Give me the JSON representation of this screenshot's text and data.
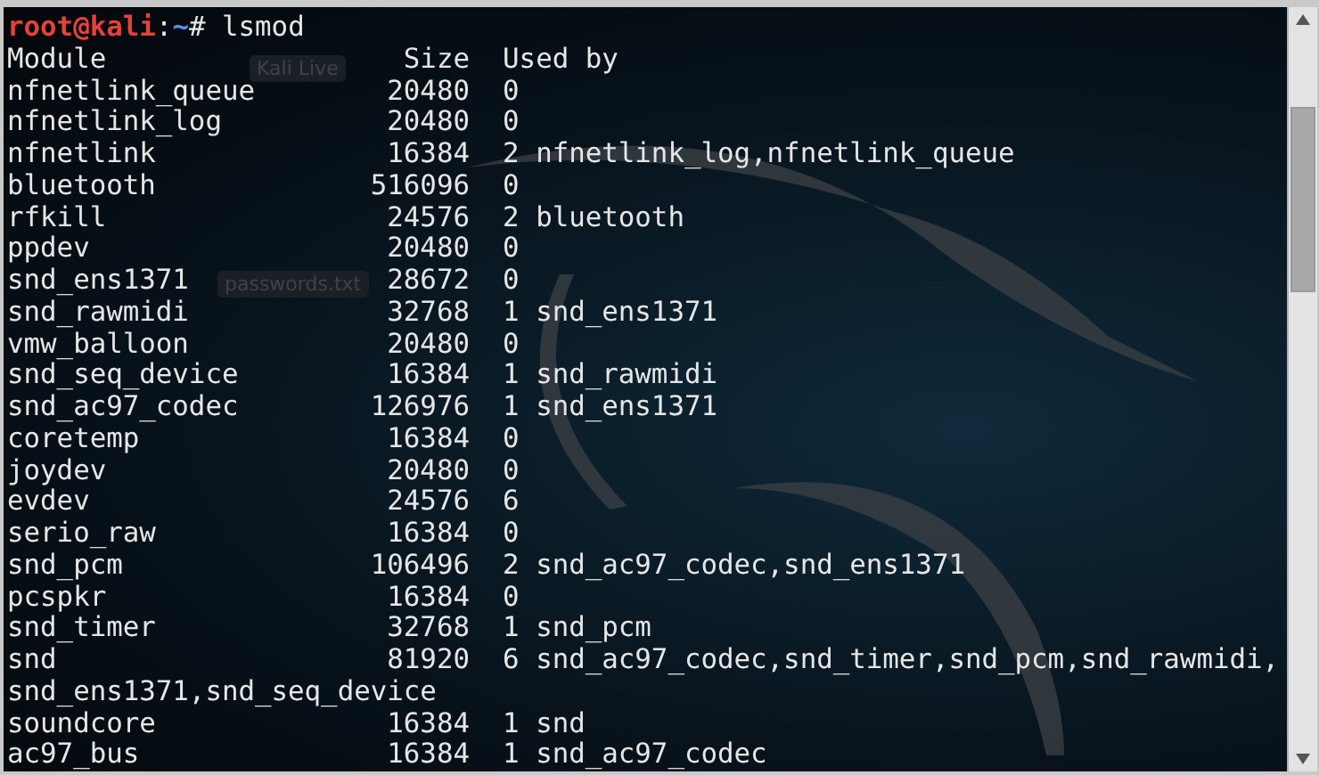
{
  "desktop_icons": [
    {
      "label": "Kali Live"
    },
    {
      "label": "passwords.txt"
    }
  ],
  "terminal": {
    "prompt": {
      "user_host": "root@kali",
      "separator": ":",
      "path": "~",
      "symbol": "#",
      "command": "lsmod"
    },
    "header": {
      "module": "Module",
      "size": "Size",
      "used_by": "Used by"
    },
    "rows": [
      {
        "module": "nfnetlink_queue",
        "size": "20480",
        "count": "0",
        "used_by": ""
      },
      {
        "module": "nfnetlink_log",
        "size": "20480",
        "count": "0",
        "used_by": ""
      },
      {
        "module": "nfnetlink",
        "size": "16384",
        "count": "2",
        "used_by": "nfnetlink_log,nfnetlink_queue"
      },
      {
        "module": "bluetooth",
        "size": "516096",
        "count": "0",
        "used_by": ""
      },
      {
        "module": "rfkill",
        "size": "24576",
        "count": "2",
        "used_by": "bluetooth"
      },
      {
        "module": "ppdev",
        "size": "20480",
        "count": "0",
        "used_by": ""
      },
      {
        "module": "snd_ens1371",
        "size": "28672",
        "count": "0",
        "used_by": ""
      },
      {
        "module": "snd_rawmidi",
        "size": "32768",
        "count": "1",
        "used_by": "snd_ens1371"
      },
      {
        "module": "vmw_balloon",
        "size": "20480",
        "count": "0",
        "used_by": ""
      },
      {
        "module": "snd_seq_device",
        "size": "16384",
        "count": "1",
        "used_by": "snd_rawmidi"
      },
      {
        "module": "snd_ac97_codec",
        "size": "126976",
        "count": "1",
        "used_by": "snd_ens1371"
      },
      {
        "module": "coretemp",
        "size": "16384",
        "count": "0",
        "used_by": ""
      },
      {
        "module": "joydev",
        "size": "20480",
        "count": "0",
        "used_by": ""
      },
      {
        "module": "evdev",
        "size": "24576",
        "count": "6",
        "used_by": ""
      },
      {
        "module": "serio_raw",
        "size": "16384",
        "count": "0",
        "used_by": ""
      },
      {
        "module": "snd_pcm",
        "size": "106496",
        "count": "2",
        "used_by": "snd_ac97_codec,snd_ens1371"
      },
      {
        "module": "pcspkr",
        "size": "16384",
        "count": "0",
        "used_by": ""
      },
      {
        "module": "snd_timer",
        "size": "32768",
        "count": "1",
        "used_by": "snd_pcm"
      },
      {
        "module": "snd",
        "size": "81920",
        "count": "6",
        "used_by": "snd_ac97_codec,snd_timer,snd_pcm,snd_rawmidi,",
        "continuation": "snd_ens1371,snd_seq_device"
      },
      {
        "module": "soundcore",
        "size": "16384",
        "count": "1",
        "used_by": "snd"
      },
      {
        "module": "ac97_bus",
        "size": "16384",
        "count": "1",
        "used_by": "snd_ac97_codec"
      }
    ]
  }
}
